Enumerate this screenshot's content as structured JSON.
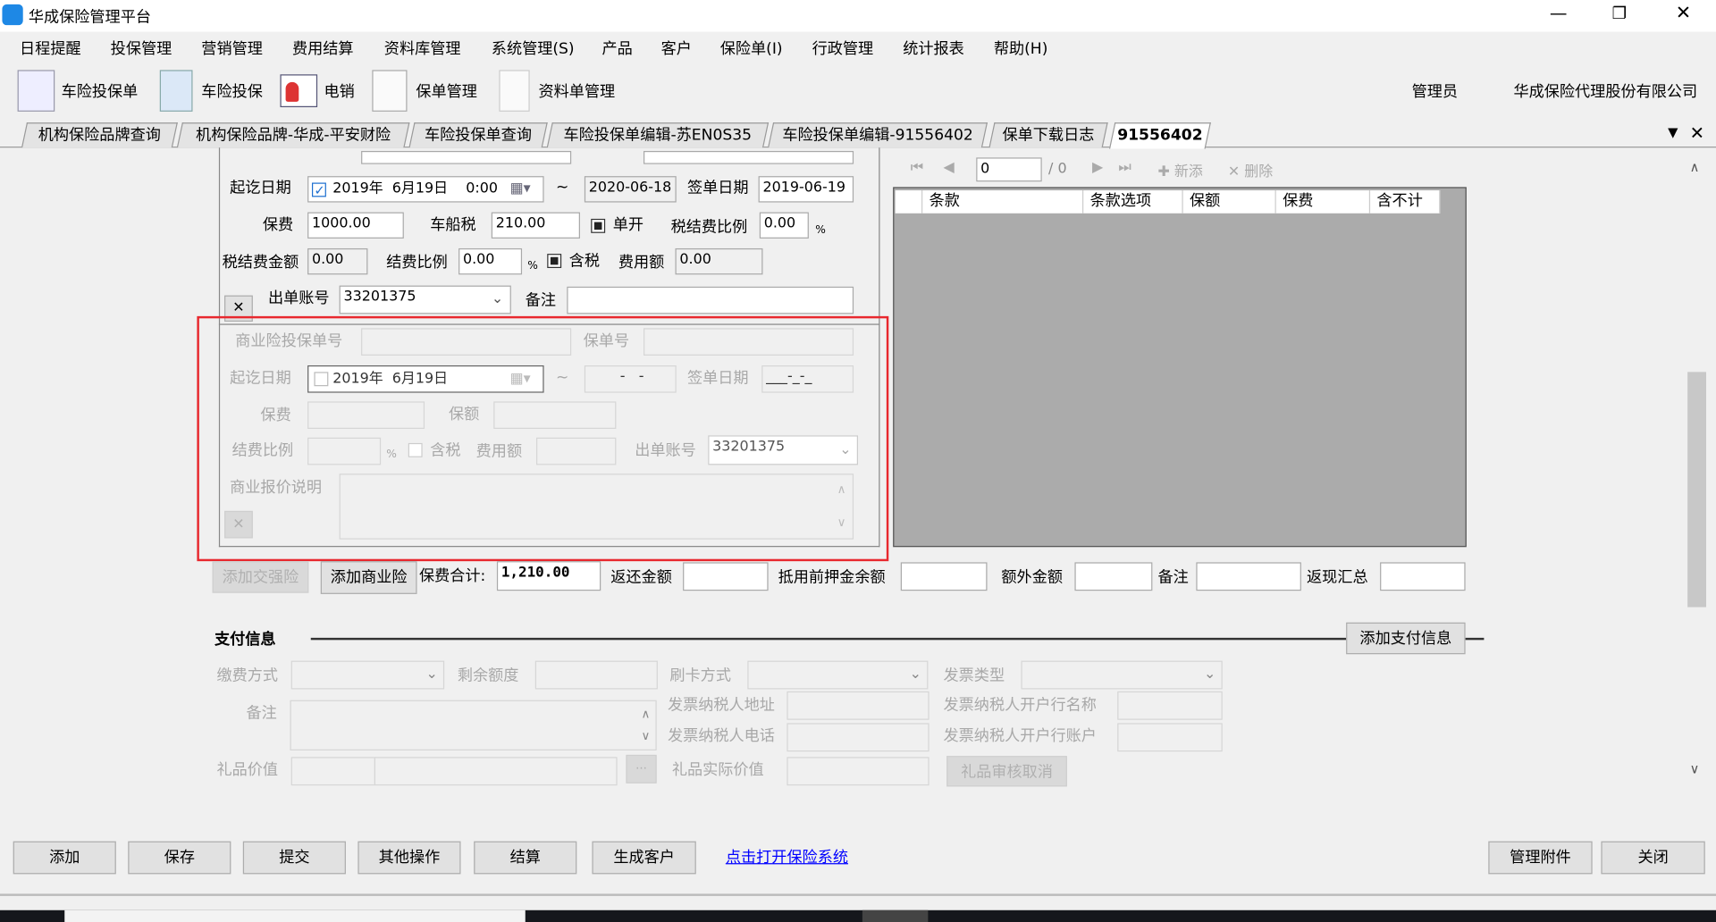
{
  "window": {
    "title": "华成保险管理平台",
    "controls": [
      "minimize",
      "restore",
      "close"
    ]
  },
  "menu": [
    "日程提醒",
    "投保管理",
    "营销管理",
    "费用结算",
    "资料库管理",
    "系统管理(S)",
    "产品",
    "客户",
    "保险单(I)",
    "行政管理",
    "统计报表",
    "帮助(H)"
  ],
  "toolbar": {
    "items": [
      "车险投保单",
      "车险投保",
      "电销",
      "保单管理",
      "资料单管理"
    ],
    "user": "管理员",
    "company": "华成保险代理股份有限公司"
  },
  "tabs": [
    "机构保险品牌查询",
    "机构保险品牌-华成-平安财险",
    "车险投保单查询",
    "车险投保单编辑-苏EN0S35",
    "车险投保单编辑-91556402",
    "保单下载日志",
    "91556402"
  ],
  "compulsory": {
    "date_label": "起讫日期",
    "start_date": "2019年  6月19日    0:00",
    "tilde": "~",
    "end_date": "2020-06-18",
    "sign_date_label": "签单日期",
    "sign_date": "2019-06-19",
    "premium_label": "保费",
    "premium": "1000.00",
    "vessel_tax_label": "车船税",
    "vessel_tax": "210.00",
    "separate_label": "单开",
    "tax_fee_ratio_label": "税结费比例",
    "tax_fee_ratio": "0.00",
    "percent": "%",
    "tax_fee_amount_label": "税结费金额",
    "tax_fee_amount": "0.00",
    "fee_ratio_label": "结费比例",
    "fee_ratio": "0.00",
    "tax_incl_label": "含税",
    "fee_amount_label": "费用额",
    "fee_amount": "0.00",
    "account_label": "出单账号",
    "account": "33201375",
    "remark_label": "备注",
    "remove": "✕"
  },
  "commercial": {
    "proposal_no_label": "商业险投保单号",
    "policy_no_label": "保单号",
    "date_label": "起讫日期",
    "start_date": "2019年  6月19日",
    "end_date": "-   -",
    "sign_date_label": "签单日期",
    "sign_date": "___-_-_",
    "premium_label": "保费",
    "insured_amount_label": "保额",
    "fee_ratio_label": "结费比例",
    "tax_incl_label": "含税",
    "fee_amount_label": "费用额",
    "account_label": "出单账号",
    "account": "33201375",
    "quote_note_label": "商业报价说明",
    "remove": "✕"
  },
  "clause_grid": {
    "page": "0",
    "total": "/ 0",
    "add": "新添",
    "delete": "删除",
    "columns": [
      "条款",
      "条款选项",
      "保额",
      "保费",
      "含不计"
    ]
  },
  "summary": {
    "add_compulsory": "添加交强险",
    "add_commercial": "添加商业险",
    "total_label": "保费合计:",
    "total": "1,210.00",
    "refund_label": "返还金额",
    "deposit_label": "抵用前押金余额",
    "extra_label": "额外金额",
    "remark_label": "备注",
    "cashback_label": "返现汇总"
  },
  "payment": {
    "title": "支付信息",
    "add_button": "添加支付信息",
    "method_label": "缴费方式",
    "balance_label": "剩余额度",
    "card_label": "刷卡方式",
    "invoice_type_label": "发票类型",
    "remark_label": "备注",
    "taxpayer_addr_label": "发票纳税人地址",
    "bank_name_label": "发票纳税人开户行名称",
    "taxpayer_phone_label": "发票纳税人电话",
    "bank_account_label": "发票纳税人开户行账户",
    "gift_value_label": "礼品价值",
    "ellipsis": "···",
    "gift_actual_label": "礼品实际价值",
    "gift_cancel": "礼品审核取消"
  },
  "footer": {
    "buttons": [
      "添加",
      "保存",
      "提交",
      "其他操作",
      "结算",
      "生成客户"
    ],
    "link": "点击打开保险系统",
    "attachments": "管理附件",
    "close": "关闭"
  },
  "colors": {
    "highlight": "#e8282e",
    "link": "#0000ff",
    "grid_bg": "#ababab"
  }
}
